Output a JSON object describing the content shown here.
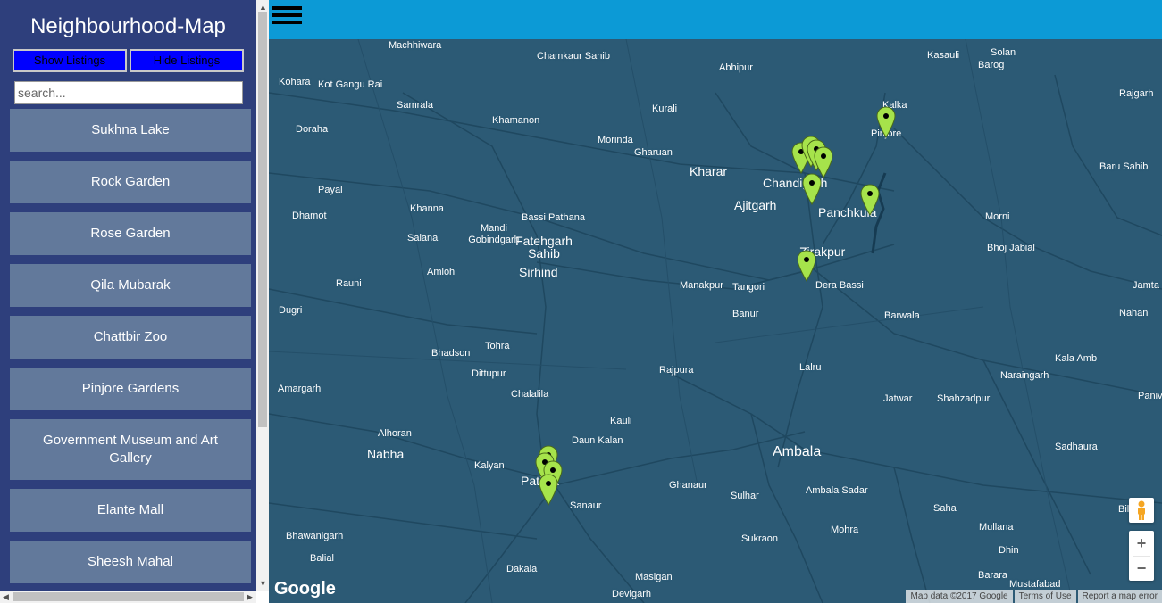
{
  "sidebar": {
    "title": "Neighbourhood-Map",
    "show_label": "Show Listings",
    "hide_label": "Hide Listings",
    "search_placeholder": "search...",
    "items": [
      {
        "label": "Sukhna Lake"
      },
      {
        "label": "Rock Garden"
      },
      {
        "label": "Rose Garden"
      },
      {
        "label": "Qila Mubarak"
      },
      {
        "label": "Chattbir Zoo"
      },
      {
        "label": "Pinjore Gardens"
      },
      {
        "label": "Government Museum and Art Gallery"
      },
      {
        "label": "Elante Mall"
      },
      {
        "label": "Sheesh Mahal"
      }
    ]
  },
  "map": {
    "places": [
      "Machhiwara",
      "Chamkaur Sahib",
      "Abhipur",
      "Kasauli",
      "Solan",
      "Barog",
      "Kohara",
      "Kot Gangu Rai",
      "Samrala",
      "Kurali",
      "Kalka",
      "Rajgarh",
      "Khamanon",
      "Doraha",
      "Morinda",
      "Gharuan",
      "Pinjore",
      "Kharar",
      "Baru Sahib",
      "Payal",
      "Chandigarh",
      "Ajitgarh",
      "Panchkula",
      "Khanna",
      "Mandi Gobindgarh",
      "Bassi Pathana",
      "Dhamot",
      "Morni",
      "Fatehgarh Sahib",
      "Salana",
      "Zirakpur",
      "Bhoj Jabial",
      "Amloh",
      "Sirhind",
      "Rauni",
      "Manakpur",
      "Tangori",
      "Dera Bassi",
      "Jamta",
      "Dugri",
      "Banur",
      "Barwala",
      "Nahan",
      "Tohra",
      "Bhadson",
      "Rajpura",
      "Kala Amb",
      "Dittupur",
      "Lalru",
      "Naraingarh",
      "Amargarh",
      "Chalalila",
      "Jatwar",
      "Shahzadpur",
      "Kauli",
      "Alhoran",
      "Daun Kalan",
      "Nabha",
      "Ambala",
      "Kalyan",
      "Sadhaura",
      "Patiala",
      "Ghanaur",
      "Sulhar",
      "Ambala Sadar",
      "Sanaur",
      "Bhawanigarh",
      "Saha",
      "Mullana",
      "Sukraon",
      "Mohra",
      "Balial",
      "Dhin",
      "Dakala",
      "Barara",
      "Masigan",
      "Devigarh",
      "Mustafabad",
      "Panivala",
      "Bilaspur"
    ],
    "marker_color": "#a6e34b",
    "google": "Google",
    "attribution": [
      "Map data ©2017 Google",
      "Terms of Use",
      "Report a map error"
    ]
  },
  "icons": {
    "menu": "hamburger-icon",
    "pegman": "pegman-icon",
    "zoom_in": "+",
    "zoom_out": "−"
  }
}
